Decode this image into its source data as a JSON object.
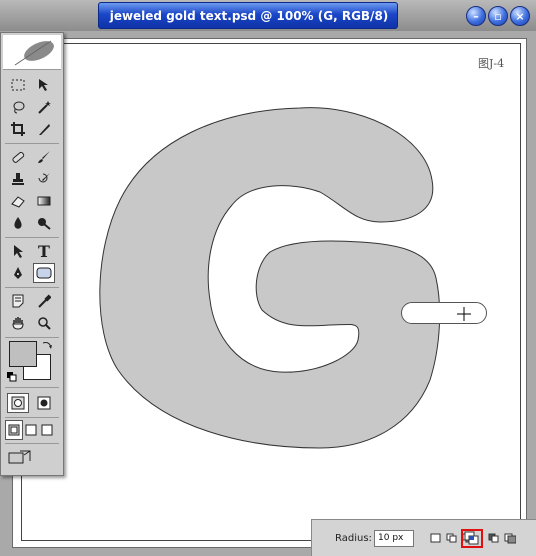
{
  "window": {
    "title": "jeweled gold text.psd @ 100% (G, RGB/8)",
    "buttons": [
      "minimize",
      "maximize",
      "close"
    ]
  },
  "canvas": {
    "figure_label": "图J-4",
    "shape_fill": "#c8c8c8"
  },
  "toolbox": {
    "tools": [
      "marquee",
      "move",
      "lasso",
      "magic-wand",
      "crop",
      "slice",
      "healing-brush",
      "brush",
      "clone-stamp",
      "history-brush",
      "eraser",
      "gradient",
      "blur",
      "dodge",
      "path-selection",
      "type",
      "pen",
      "rounded-rectangle",
      "notes",
      "eyedropper",
      "hand",
      "zoom"
    ],
    "selected_tool": "rounded-rectangle",
    "foreground_color": "#bfbfbf",
    "background_color": "#ffffff"
  },
  "options_bar": {
    "radius_label": "Radius:",
    "radius_value": "10 px",
    "selected_mode": "intersect"
  },
  "icons": {
    "type_glyph": "T"
  }
}
